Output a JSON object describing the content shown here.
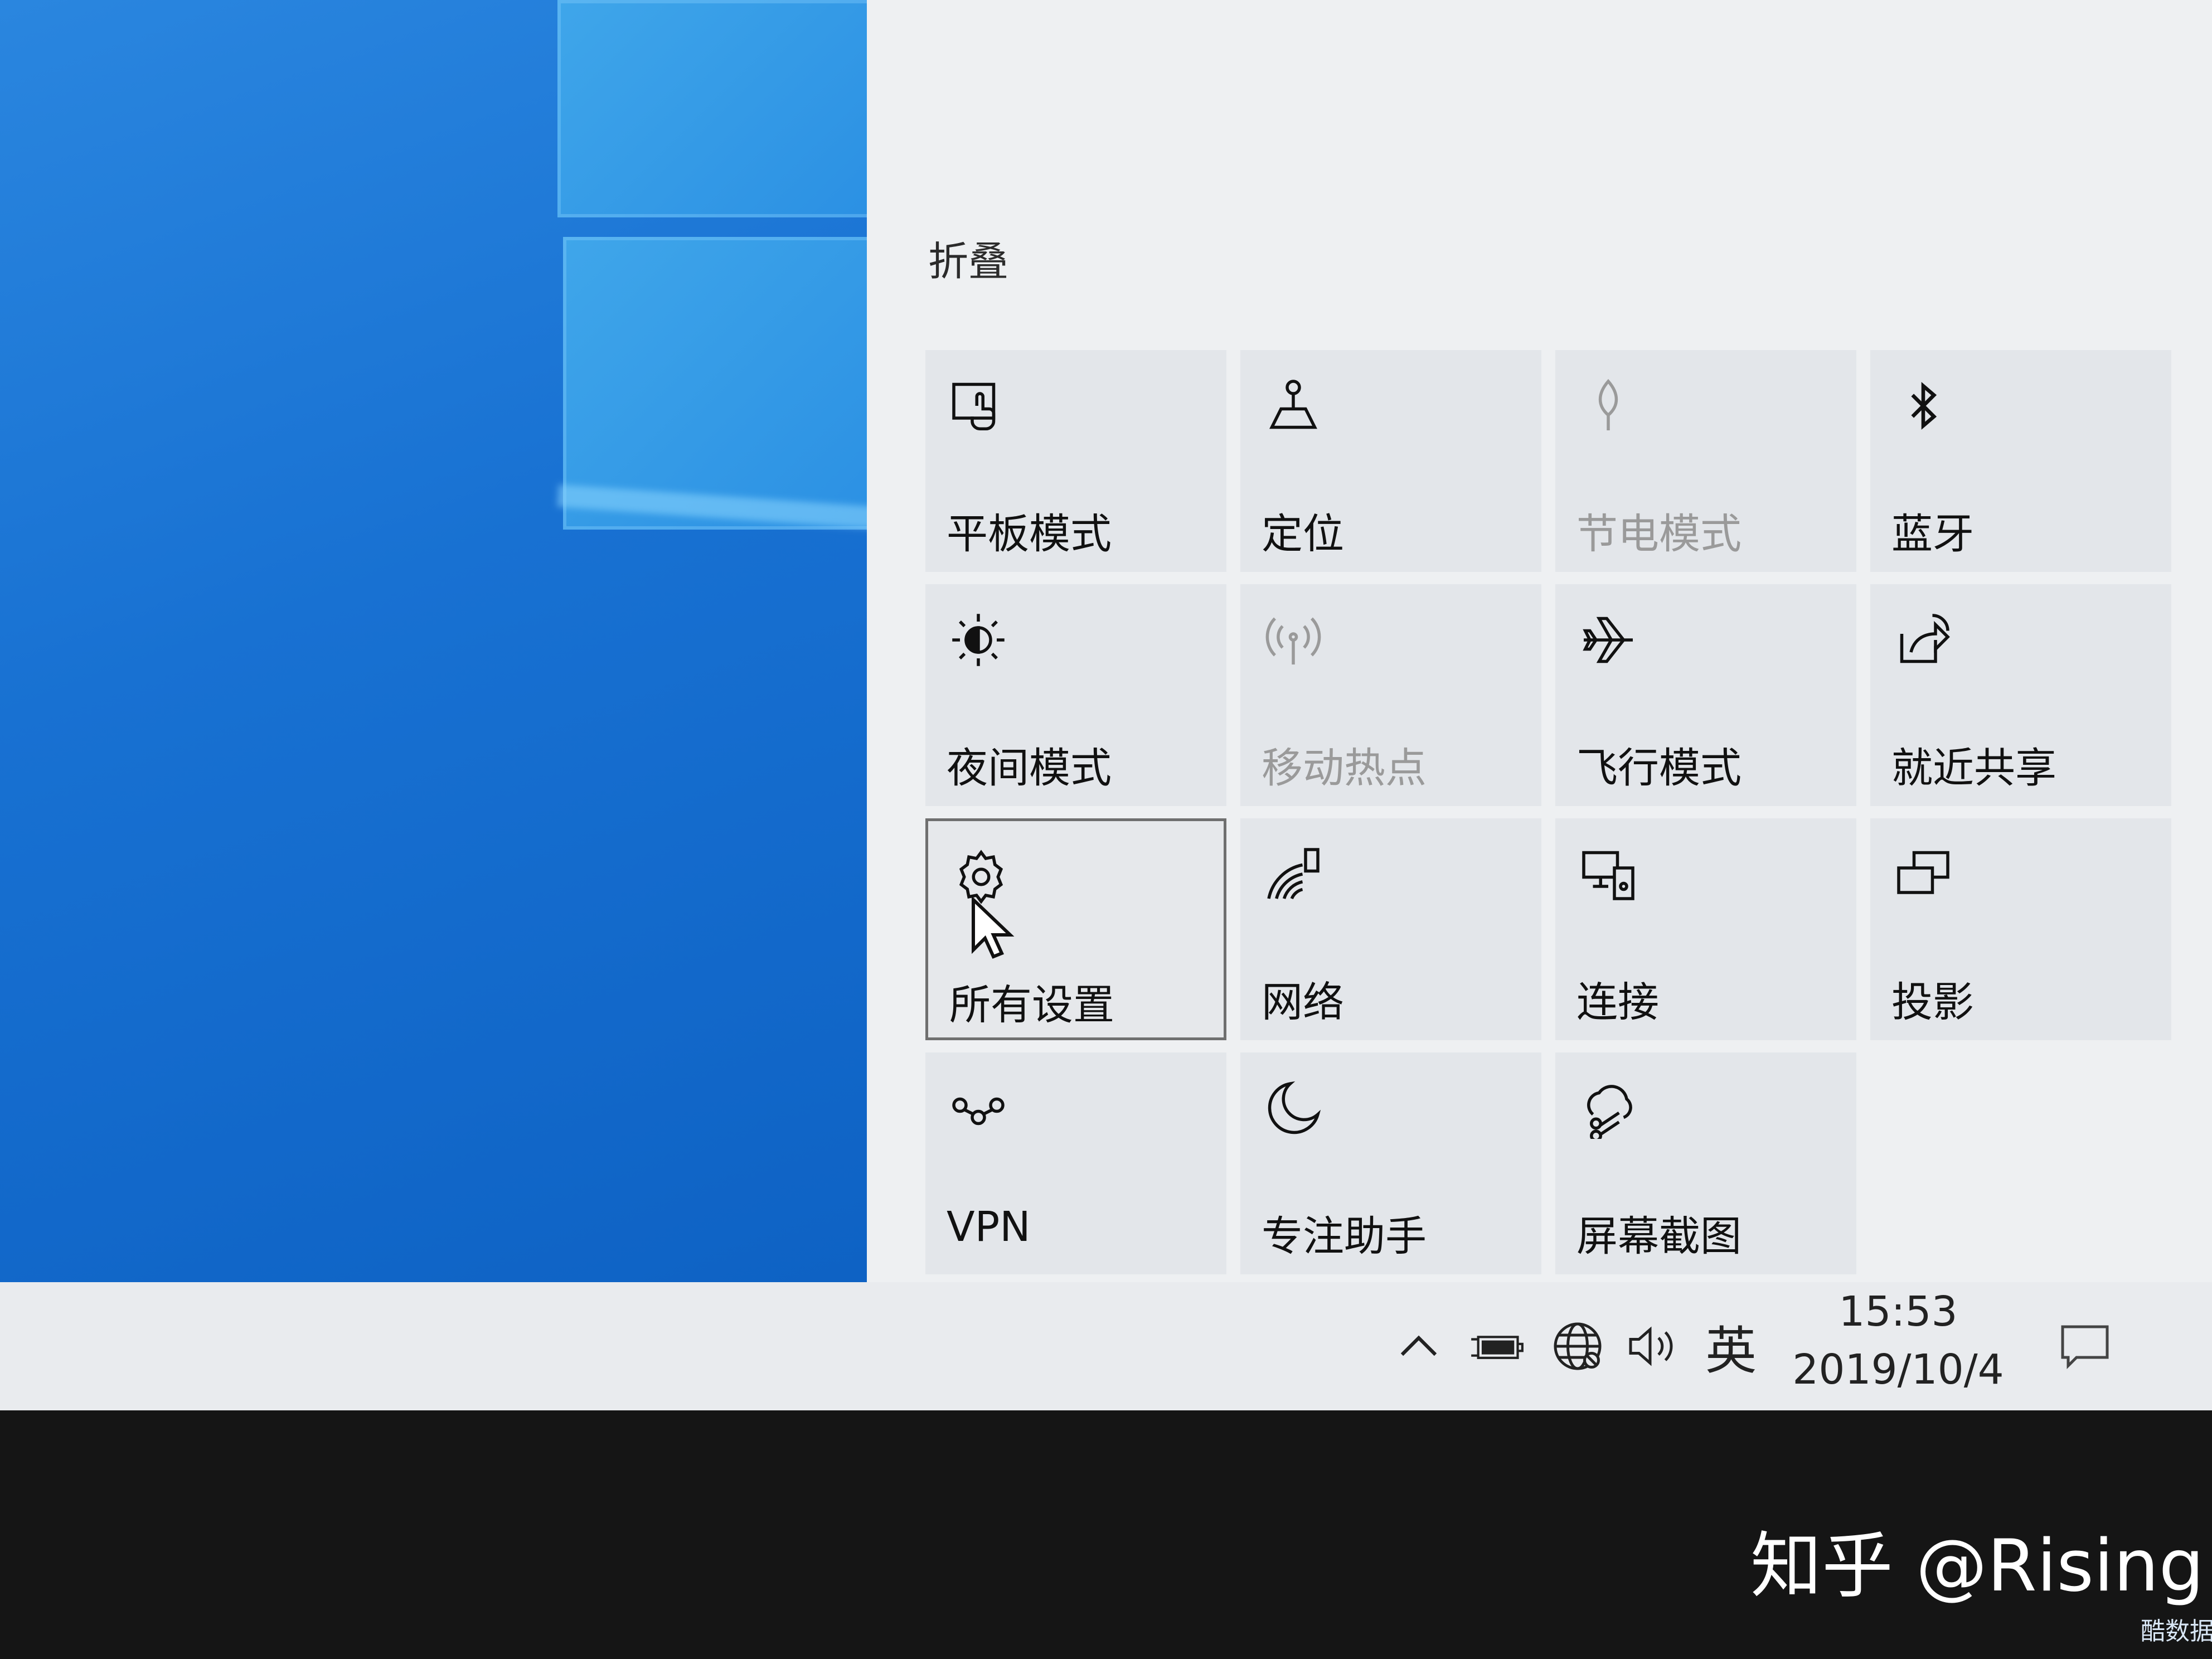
{
  "action_center": {
    "collapse_label": "折叠",
    "tiles": [
      {
        "label": "平板模式",
        "icon": "tablet-mode-icon",
        "disabled": false,
        "selected": false
      },
      {
        "label": "定位",
        "icon": "location-icon",
        "disabled": false,
        "selected": false
      },
      {
        "label": "节电模式",
        "icon": "battery-saver-icon",
        "disabled": true,
        "selected": false
      },
      {
        "label": "蓝牙",
        "icon": "bluetooth-icon",
        "disabled": false,
        "selected": false
      },
      {
        "label": "夜间模式",
        "icon": "night-light-icon",
        "disabled": false,
        "selected": false
      },
      {
        "label": "移动热点",
        "icon": "mobile-hotspot-icon",
        "disabled": true,
        "selected": false
      },
      {
        "label": "飞行模式",
        "icon": "airplane-icon",
        "disabled": false,
        "selected": false
      },
      {
        "label": "就近共享",
        "icon": "nearby-share-icon",
        "disabled": false,
        "selected": false
      },
      {
        "label": "所有设置",
        "icon": "gear-icon",
        "disabled": false,
        "selected": true
      },
      {
        "label": "网络",
        "icon": "network-icon",
        "disabled": false,
        "selected": false
      },
      {
        "label": "连接",
        "icon": "connect-icon",
        "disabled": false,
        "selected": false
      },
      {
        "label": "投影",
        "icon": "project-icon",
        "disabled": false,
        "selected": false
      },
      {
        "label": "VPN",
        "icon": "vpn-icon",
        "disabled": false,
        "selected": false
      },
      {
        "label": "专注助手",
        "icon": "focus-assist-icon",
        "disabled": false,
        "selected": false
      },
      {
        "label": "屏幕截图",
        "icon": "screen-snip-icon",
        "disabled": false,
        "selected": false
      }
    ]
  },
  "taskbar": {
    "ime": "英",
    "time": "15:53",
    "date": "2019/10/4"
  },
  "watermark": {
    "text": "知乎 @Rising",
    "corner_badge": "酷数据"
  },
  "colors": {
    "desktop_blue": "#1871d2",
    "panel_bg": "#eef0f2",
    "tile_bg": "#e3e6ea",
    "disabled_text": "#9a9a9a"
  }
}
